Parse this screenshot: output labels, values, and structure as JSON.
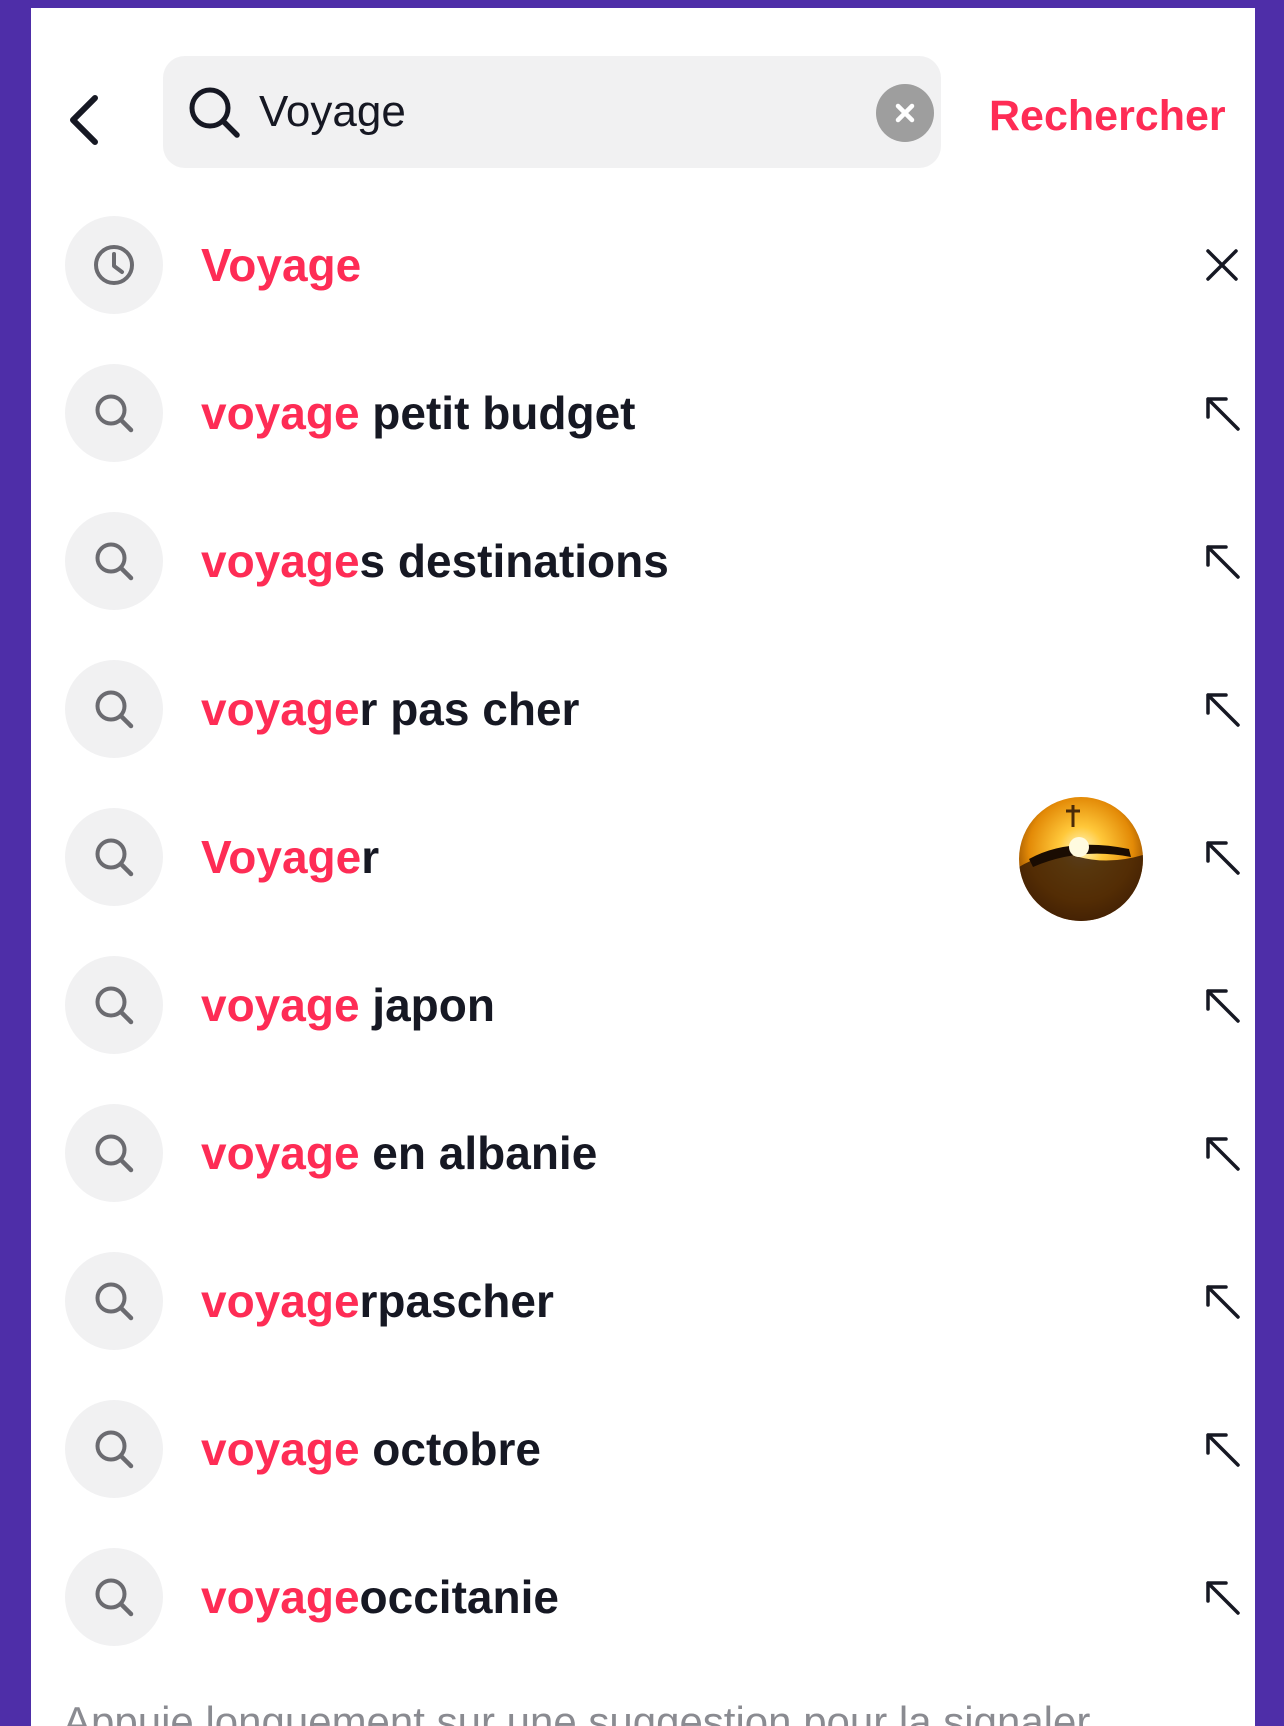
{
  "header": {
    "back_icon": "chevron-left-icon",
    "search_icon": "search-icon",
    "search_value": "Voyage",
    "clear_icon": "clear-circle-icon",
    "submit_label": "Rechercher"
  },
  "colors": {
    "accent": "#fe2c55",
    "text": "#161823",
    "muted": "#8a8b91",
    "chip": "#f1f1f2",
    "frame": "#4e2ea8"
  },
  "suggestions": [
    {
      "kind": "history",
      "icon": "clock-icon",
      "highlight": "Voyage",
      "rest": "",
      "action_icon": "close-icon"
    },
    {
      "kind": "suggestion",
      "icon": "search-icon",
      "highlight": "voyage",
      "rest": " petit budget",
      "action_icon": "arrow-up-left-icon"
    },
    {
      "kind": "suggestion",
      "icon": "search-icon",
      "highlight": "voyage",
      "rest": "s destinations",
      "action_icon": "arrow-up-left-icon"
    },
    {
      "kind": "suggestion",
      "icon": "search-icon",
      "highlight": "voyage",
      "rest": "r pas cher",
      "action_icon": "arrow-up-left-icon"
    },
    {
      "kind": "suggestion",
      "icon": "search-icon",
      "highlight": "Voyage",
      "rest": "r",
      "action_icon": "arrow-up-left-icon",
      "thumbnail": "sunset-thumbnail"
    },
    {
      "kind": "suggestion",
      "icon": "search-icon",
      "highlight": "voyage",
      "rest": " japon",
      "action_icon": "arrow-up-left-icon"
    },
    {
      "kind": "suggestion",
      "icon": "search-icon",
      "highlight": "voyage",
      "rest": " en albanie",
      "action_icon": "arrow-up-left-icon"
    },
    {
      "kind": "suggestion",
      "icon": "search-icon",
      "highlight": "voyage",
      "rest": "rpascher",
      "action_icon": "arrow-up-left-icon"
    },
    {
      "kind": "suggestion",
      "icon": "search-icon",
      "highlight": "voyage",
      "rest": " octobre",
      "action_icon": "arrow-up-left-icon"
    },
    {
      "kind": "suggestion",
      "icon": "search-icon",
      "highlight": "voyage",
      "rest": "occitanie",
      "action_icon": "arrow-up-left-icon"
    }
  ],
  "footer_note": "Appuie longuement sur une suggestion pour la signaler"
}
